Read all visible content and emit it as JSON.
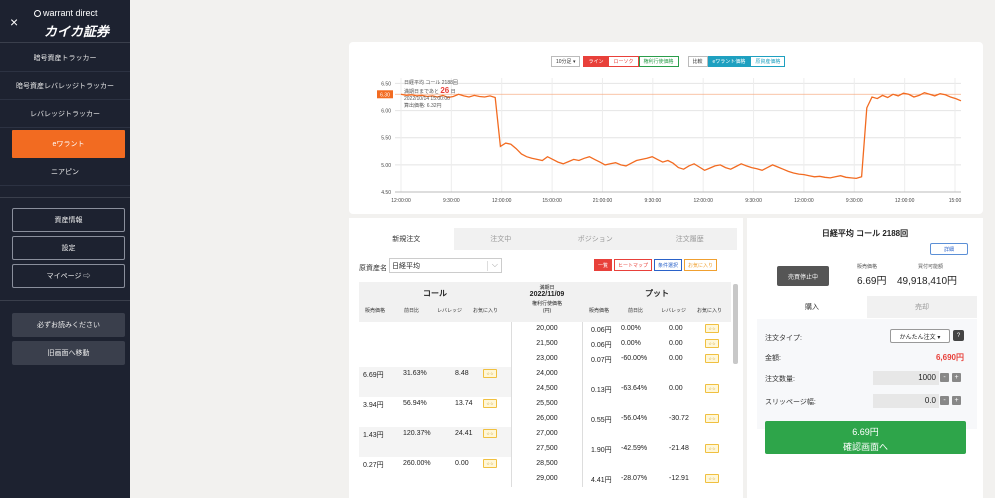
{
  "sidebar": {
    "brand_sub": "warrant direct",
    "brand_main": "カイカ証券",
    "close_icon": "×",
    "items": [
      {
        "label": "暗号資産トラッカー",
        "active": false
      },
      {
        "label": "暗号資産レバレッジトラッカー",
        "active": false
      },
      {
        "label": "レバレッジトラッカー",
        "active": false
      },
      {
        "label": "eワラント",
        "active": true
      },
      {
        "label": "ニアピン",
        "active": false
      }
    ],
    "boxes": [
      {
        "label": "資産情報"
      },
      {
        "label": "設定"
      },
      {
        "label": "マイページ ⇨"
      }
    ],
    "buttons": [
      {
        "label": "必ずお読みください"
      },
      {
        "label": "旧画面へ移動"
      }
    ],
    "accent_color": "#f26b21",
    "bg_color": "#1d2230"
  },
  "chart": {
    "controls_left": [
      {
        "label": "10分足 ▾",
        "style": "plain"
      },
      {
        "label": "ライン",
        "style": "red"
      },
      {
        "label": "ローソク",
        "style": "red-o"
      },
      {
        "label": "権利行使価格",
        "style": "green-o"
      }
    ],
    "controls_right": [
      {
        "label": "比較",
        "style": "plain"
      },
      {
        "label": "eワラント価格",
        "style": "teal"
      },
      {
        "label": "原資産価格",
        "style": "teal-o"
      }
    ],
    "legend": {
      "title": "日経平均 コール 2188回",
      "remaining_prefix": "満期日まであと",
      "remaining_days": "26",
      "remaining_suffix": "日",
      "datetime": "2022/10/14 15:00:00",
      "price_line": "算出価格: 6.32円"
    },
    "price_marker": "6.30"
  },
  "chart_data": {
    "type": "line",
    "title": "日経平均 コール 2188回",
    "ylim": [
      4.5,
      6.6
    ],
    "yticks": [
      "6.50",
      "6.00",
      "5.50",
      "5.00",
      "4.50"
    ],
    "ytick_values": [
      6.5,
      6.0,
      5.5,
      5.0,
      4.5
    ],
    "xtick_labels": [
      "12:00:00",
      "9:30:00",
      "12:00:00",
      "15:00:00",
      "21:00:00",
      "9:30:00",
      "12:00:00",
      "9:30:00",
      "12:00:00",
      "9:30:00",
      "12:00:00",
      "15:00"
    ],
    "grid": true,
    "series": [
      {
        "color": "#f26b21",
        "values": [
          6.3,
          6.28,
          6.29,
          6.27,
          6.28,
          6.26,
          6.27,
          6.25,
          6.28,
          6.24,
          6.26,
          6.3,
          6.27,
          6.25,
          6.28,
          6.26,
          6.25,
          6.27,
          6.24,
          5.34,
          5.4,
          5.38,
          5.3,
          5.2,
          5.15,
          5.12,
          5.1,
          5.08,
          5.15,
          5.1,
          5.05,
          5.02,
          5.06,
          5.1,
          5.08,
          5.12,
          5.15,
          5.1,
          5.05,
          5.0,
          5.02,
          5.04,
          5.0,
          4.98,
          5.03,
          5.08,
          5.1,
          5.12,
          5.15,
          5.1,
          5.05,
          5.08,
          5.03,
          4.95,
          4.92,
          4.98,
          5.02,
          4.96,
          4.9,
          4.94,
          4.98,
          5.0,
          4.95,
          4.92,
          4.97,
          5.02,
          4.98,
          4.95,
          4.93,
          4.9,
          4.95,
          5.0,
          4.96,
          4.92,
          4.88,
          4.85,
          4.83,
          4.82,
          4.8,
          4.78,
          4.79,
          4.77,
          4.76,
          4.78,
          4.8,
          4.77,
          4.76,
          4.75,
          4.78,
          6.05,
          6.25,
          6.22,
          6.28,
          6.24,
          6.3,
          6.27,
          6.32,
          6.3,
          6.25,
          6.28,
          6.33,
          6.3,
          6.27,
          6.31,
          6.29,
          6.25,
          6.22,
          6.18
        ]
      }
    ]
  },
  "orders": {
    "tabs": [
      {
        "label": "新規注文",
        "active": true
      },
      {
        "label": "注文中",
        "active": false
      },
      {
        "label": "ポジション",
        "active": false
      },
      {
        "label": "注文履歴",
        "active": false
      }
    ],
    "underlying_label": "原資産名",
    "underlying_value": "日経平均",
    "view_buttons": [
      {
        "label": "一覧",
        "style": "red"
      },
      {
        "label": "ヒートマップ",
        "style": "red-o"
      },
      {
        "label": "条件選択",
        "style": "blue-o"
      },
      {
        "label": "お気に入り",
        "style": "orange-o"
      }
    ],
    "header": {
      "call": "コール",
      "put": "プット",
      "expiry_label": "満期日",
      "expiry": "2022/11/09",
      "strike_label": "権利行使価格",
      "strike_unit": "(円)",
      "cols": [
        "販売価格",
        "前日比",
        "レバレッジ",
        "お気に入り"
      ]
    },
    "fav_label": "☆☆",
    "rows": [
      {
        "call": null,
        "strike": "20,000",
        "put": {
          "price": "0.06円",
          "change": "0.00%",
          "lev": "0.00"
        }
      },
      {
        "call": null,
        "strike": "21,500",
        "put": {
          "price": "0.06円",
          "change": "0.00%",
          "lev": "0.00"
        }
      },
      {
        "call": null,
        "strike": "23,000",
        "put": {
          "price": "0.07円",
          "change": "-60.00%",
          "lev": "0.00"
        }
      },
      {
        "call": {
          "price": "6.69円",
          "change": "31.63%",
          "lev": "8.48"
        },
        "strike": "24,000",
        "put": null
      },
      {
        "call": null,
        "strike": "24,500",
        "put": {
          "price": "0.13円",
          "change": "-63.64%",
          "lev": "0.00"
        }
      },
      {
        "call": {
          "price": "3.94円",
          "change": "56.94%",
          "lev": "13.74"
        },
        "strike": "25,500",
        "put": null
      },
      {
        "call": null,
        "strike": "26,000",
        "put": {
          "price": "0.55円",
          "change": "-56.04%",
          "lev": "-30.72"
        }
      },
      {
        "call": {
          "price": "1.43円",
          "change": "120.37%",
          "lev": "24.41"
        },
        "strike": "27,000",
        "put": null
      },
      {
        "call": null,
        "strike": "27,500",
        "put": {
          "price": "1.90円",
          "change": "-42.59%",
          "lev": "-21.48"
        }
      },
      {
        "call": {
          "price": "0.27円",
          "change": "260.00%",
          "lev": "0.00"
        },
        "strike": "28,500",
        "put": null
      },
      {
        "call": null,
        "strike": "29,000",
        "put": {
          "price": "4.41円",
          "change": "-28.07%",
          "lev": "-12.91"
        }
      }
    ]
  },
  "trade": {
    "title": "日経平均 コール 2188回",
    "detail_label": "詳細",
    "stop_label": "売買停止中",
    "sell_price_label": "販売価格",
    "sell_price": "6.69円",
    "buy_power_label": "買付可能額",
    "buy_power": "49,918,410円",
    "tabs": [
      {
        "label": "購入",
        "active": true
      },
      {
        "label": "売却",
        "active": false
      }
    ],
    "order_type_label": "注文タイプ:",
    "order_type_value": "かんたん注文 ▾",
    "help_label": "?",
    "amount_label": "金額:",
    "amount_value": "6,690円",
    "qty_label": "注文数量:",
    "qty_value": "1000",
    "slippage_label": "スリッページ幅:",
    "slippage_value": "0.0",
    "minus": "-",
    "plus": "+",
    "confirm_price": "6.69円",
    "confirm_label": "確認画面へ",
    "confirm_color": "#2ea54a"
  }
}
